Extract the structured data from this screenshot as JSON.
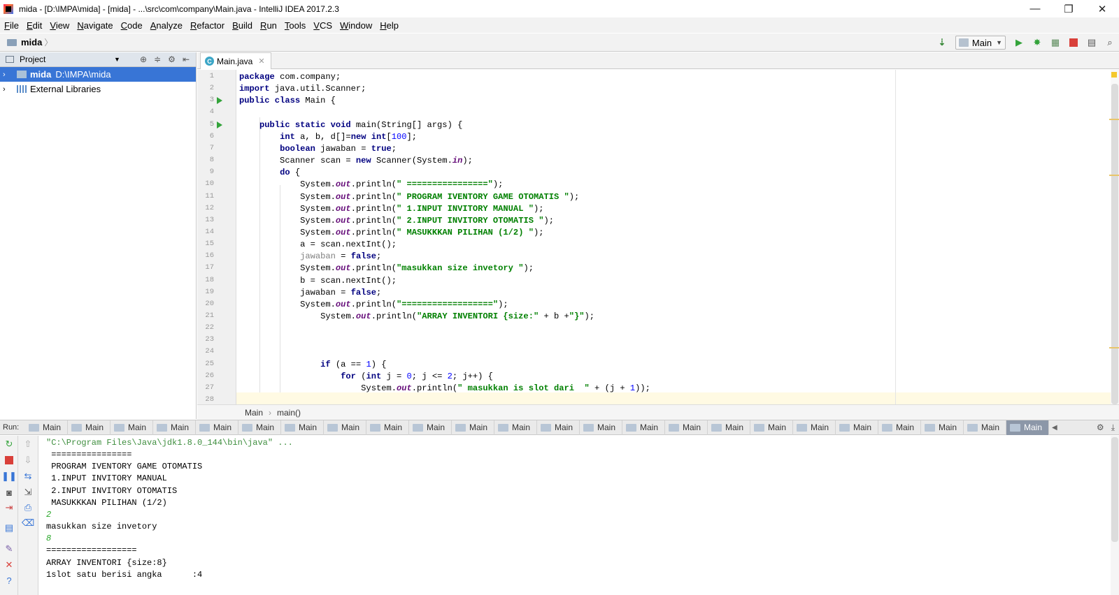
{
  "window": {
    "title": "mida - [D:\\IMPA\\mida] - [mida] - ...\\src\\com\\company\\Main.java - IntelliJ IDEA 2017.2.3",
    "minimize": "—",
    "restore": "❐",
    "close": "✕"
  },
  "menu": [
    "File",
    "Edit",
    "View",
    "Navigate",
    "Code",
    "Analyze",
    "Refactor",
    "Build",
    "Run",
    "Tools",
    "VCS",
    "Window",
    "Help"
  ],
  "navbar": {
    "project": "mida",
    "run_config": "Main"
  },
  "project_panel": {
    "title": "Project",
    "tree": [
      {
        "name": "mida",
        "path": "D:\\IMPA\\mida",
        "selected": true
      },
      {
        "name": "External Libraries",
        "path": "",
        "selected": false
      }
    ]
  },
  "editor": {
    "tab": "Main.java",
    "breadcrumb": [
      "Main",
      "main()"
    ],
    "lines": [
      {
        "n": "1",
        "segs": [
          [
            "kw",
            "package"
          ],
          [
            "t",
            " com.company;"
          ]
        ]
      },
      {
        "n": "2",
        "segs": [
          [
            "kw",
            "import"
          ],
          [
            "t",
            " java.util.Scanner;"
          ]
        ]
      },
      {
        "n": "3",
        "segs": [
          [
            "kw",
            "public class"
          ],
          [
            "t",
            " Main {"
          ]
        ]
      },
      {
        "n": "4",
        "segs": []
      },
      {
        "n": "5",
        "segs": [
          [
            "t",
            "    "
          ],
          [
            "kw",
            "public static void"
          ],
          [
            "t",
            " main(String[] args) {"
          ]
        ]
      },
      {
        "n": "6",
        "segs": [
          [
            "t",
            "        "
          ],
          [
            "kw",
            "int"
          ],
          [
            "t",
            " a, b, d[]="
          ],
          [
            "kw",
            "new int"
          ],
          [
            "t",
            "["
          ],
          [
            "num",
            "100"
          ],
          [
            "t",
            "];"
          ]
        ]
      },
      {
        "n": "7",
        "segs": [
          [
            "t",
            "        "
          ],
          [
            "kw",
            "boolean"
          ],
          [
            "t",
            " jawaban = "
          ],
          [
            "kw",
            "true"
          ],
          [
            "t",
            ";"
          ]
        ]
      },
      {
        "n": "8",
        "segs": [
          [
            "t",
            "        Scanner scan = "
          ],
          [
            "kw",
            "new"
          ],
          [
            "t",
            " Scanner(System."
          ],
          [
            "fld",
            "in"
          ],
          [
            "t",
            ");"
          ]
        ]
      },
      {
        "n": "9",
        "segs": [
          [
            "t",
            "        "
          ],
          [
            "kw",
            "do"
          ],
          [
            "t",
            " {"
          ]
        ]
      },
      {
        "n": "10",
        "segs": [
          [
            "t",
            "            System."
          ],
          [
            "fld",
            "out"
          ],
          [
            "t",
            ".println("
          ],
          [
            "str",
            "\" ================\""
          ],
          [
            "t",
            ");"
          ]
        ]
      },
      {
        "n": "11",
        "segs": [
          [
            "t",
            "            System."
          ],
          [
            "fld",
            "out"
          ],
          [
            "t",
            ".println("
          ],
          [
            "str",
            "\" PROGRAM IVENTORY GAME OTOMATIS \""
          ],
          [
            "t",
            ");"
          ]
        ]
      },
      {
        "n": "12",
        "segs": [
          [
            "t",
            "            System."
          ],
          [
            "fld",
            "out"
          ],
          [
            "t",
            ".println("
          ],
          [
            "str",
            "\" 1.INPUT INVITORY MANUAL \""
          ],
          [
            "t",
            ");"
          ]
        ]
      },
      {
        "n": "13",
        "segs": [
          [
            "t",
            "            System."
          ],
          [
            "fld",
            "out"
          ],
          [
            "t",
            ".println("
          ],
          [
            "str",
            "\" 2.INPUT INVITORY OTOMATIS \""
          ],
          [
            "t",
            ");"
          ]
        ]
      },
      {
        "n": "14",
        "segs": [
          [
            "t",
            "            System."
          ],
          [
            "fld",
            "out"
          ],
          [
            "t",
            ".println("
          ],
          [
            "str",
            "\" MASUKKKAN PILIHAN (1/2) \""
          ],
          [
            "t",
            ");"
          ]
        ]
      },
      {
        "n": "15",
        "segs": [
          [
            "t",
            "            a = scan.nextInt();"
          ]
        ]
      },
      {
        "n": "16",
        "segs": [
          [
            "t",
            "            "
          ],
          [
            "un",
            "jawaban"
          ],
          [
            "t",
            " = "
          ],
          [
            "kw",
            "false"
          ],
          [
            "t",
            ";"
          ]
        ]
      },
      {
        "n": "17",
        "segs": [
          [
            "t",
            "            System."
          ],
          [
            "fld",
            "out"
          ],
          [
            "t",
            ".println("
          ],
          [
            "str",
            "\"masukkan size invetory \""
          ],
          [
            "t",
            ");"
          ]
        ]
      },
      {
        "n": "18",
        "segs": [
          [
            "t",
            "            b = scan.nextInt();"
          ]
        ]
      },
      {
        "n": "19",
        "segs": [
          [
            "t",
            "            jawaban = "
          ],
          [
            "kw",
            "false"
          ],
          [
            "t",
            ";"
          ]
        ]
      },
      {
        "n": "20",
        "segs": [
          [
            "t",
            "            System."
          ],
          [
            "fld",
            "out"
          ],
          [
            "t",
            ".println("
          ],
          [
            "str",
            "\"==================\""
          ],
          [
            "t",
            ");"
          ]
        ]
      },
      {
        "n": "21",
        "segs": [
          [
            "t",
            "                System."
          ],
          [
            "fld",
            "out"
          ],
          [
            "t",
            ".println("
          ],
          [
            "str",
            "\"ARRAY INVENTORI {size:\""
          ],
          [
            "t",
            " + b +"
          ],
          [
            "str",
            "\"}\""
          ],
          [
            "t",
            ");"
          ]
        ]
      },
      {
        "n": "22",
        "segs": []
      },
      {
        "n": "23",
        "segs": []
      },
      {
        "n": "24",
        "segs": []
      },
      {
        "n": "25",
        "segs": [
          [
            "t",
            "                "
          ],
          [
            "kw",
            "if"
          ],
          [
            "t",
            " (a == "
          ],
          [
            "num",
            "1"
          ],
          [
            "t",
            ") {"
          ]
        ]
      },
      {
        "n": "26",
        "segs": [
          [
            "t",
            "                    "
          ],
          [
            "kw",
            "for"
          ],
          [
            "t",
            " ("
          ],
          [
            "kw",
            "int"
          ],
          [
            "t",
            " j = "
          ],
          [
            "num",
            "0"
          ],
          [
            "t",
            "; j <= "
          ],
          [
            "num",
            "2"
          ],
          [
            "t",
            "; j++) {"
          ]
        ]
      },
      {
        "n": "27",
        "segs": [
          [
            "t",
            "                        System."
          ],
          [
            "fld",
            "out"
          ],
          [
            "t",
            ".println("
          ],
          [
            "str",
            "\" masukkan is slot dari  \""
          ],
          [
            "t",
            " + (j + "
          ],
          [
            "num",
            "1"
          ],
          [
            "t",
            "));"
          ]
        ]
      },
      {
        "n": "28",
        "segs": []
      }
    ]
  },
  "run": {
    "label": "Run:",
    "tabs": [
      "Main",
      "Main",
      "Main",
      "Main",
      "Main",
      "Main",
      "Main",
      "Main",
      "Main",
      "Main",
      "Main",
      "Main",
      "Main",
      "Main",
      "Main",
      "Main",
      "Main",
      "Main",
      "Main",
      "Main",
      "Main",
      "Main",
      "Main",
      "Main"
    ],
    "active_tab_index": 23,
    "console": [
      {
        "text": "\"C:\\Program Files\\Java\\jdk1.8.0_144\\bin\\java\" ...",
        "kind": "cmd"
      },
      {
        "text": " ================",
        "kind": "out"
      },
      {
        "text": " PROGRAM IVENTORY GAME OTOMATIS",
        "kind": "out"
      },
      {
        "text": " 1.INPUT INVITORY MANUAL",
        "kind": "out"
      },
      {
        "text": " 2.INPUT INVITORY OTOMATIS",
        "kind": "out"
      },
      {
        "text": " MASUKKKAN PILIHAN (1/2)",
        "kind": "out"
      },
      {
        "text": "2",
        "kind": "input"
      },
      {
        "text": "masukkan size invetory",
        "kind": "out"
      },
      {
        "text": "8",
        "kind": "input"
      },
      {
        "text": "==================",
        "kind": "out"
      },
      {
        "text": "ARRAY INVENTORI {size:8}",
        "kind": "out"
      },
      {
        "text": "1slot satu berisi angka      :4",
        "kind": "out"
      }
    ]
  },
  "colors": {
    "selection": "#3875d6",
    "run_green": "#33a33a",
    "keyword": "#000080",
    "string": "#008000",
    "number": "#0000ff",
    "field": "#660e7a"
  },
  "icons": {
    "run": "run-icon",
    "debug": "debug-icon",
    "stop": "stop-icon",
    "search": "search-icon",
    "settings": "gear-icon"
  }
}
